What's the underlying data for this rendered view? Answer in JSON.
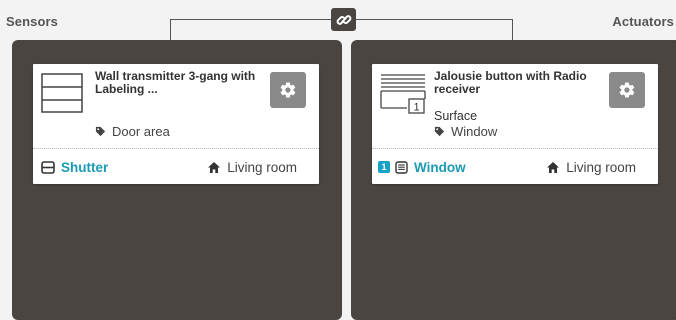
{
  "headers": {
    "left": "Sensors",
    "right": "Actuators"
  },
  "link_icon": "link-icon",
  "accent_color": "#1a9bb4",
  "sensor_card": {
    "title": "Wall transmitter 3-gang with Labeling ...",
    "location_icon": "tag-icon",
    "location": "Door area",
    "channel_icon": "shutter-icon",
    "channel": "Shutter",
    "room_icon": "home-icon",
    "room": "Living room",
    "settings_icon": "gear-icon"
  },
  "actuator_card": {
    "title": "Jalousie button with Radio receiver",
    "subtitle": "Surface",
    "device_badge": "1",
    "location_icon": "tag-icon",
    "location": "Window",
    "channel_badge": "1",
    "channel_icon": "blind-icon",
    "channel": "Window",
    "room_icon": "home-icon",
    "room": "Living room",
    "settings_icon": "gear-icon"
  }
}
